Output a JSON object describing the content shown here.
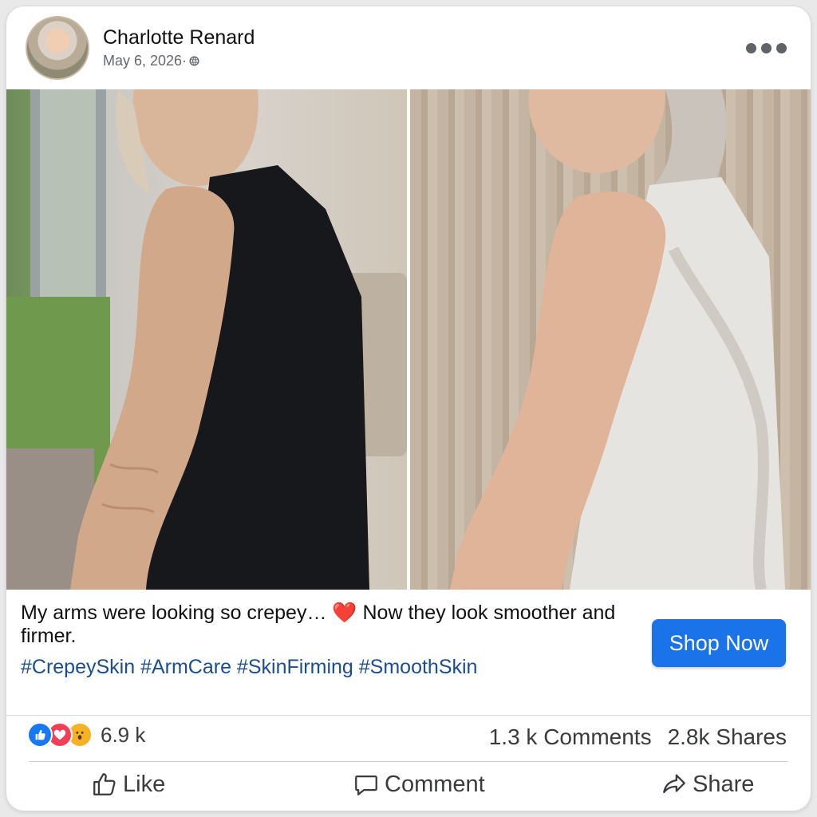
{
  "post": {
    "author": "Charlotte Renard",
    "date": "May 6, 2026·",
    "visibility_icon": "globe-icon",
    "more_icon": "more-options-icon"
  },
  "photos": {
    "before_alt": "arm before photo",
    "after_alt": "arm after photo"
  },
  "caption": {
    "text_part1": "My arms were looking so crepey… ",
    "emoji": "❤️",
    "text_part2": " Now they look smoother and firmer.",
    "hashtags": "#CrepeySkin #ArmCare #SkinFirming #SmoothSkin"
  },
  "cta": {
    "label": "Shop Now",
    "color": "#1a73e8"
  },
  "engagement": {
    "reaction_icons": [
      "like-reaction-icon",
      "love-reaction-icon",
      "wow-reaction-icon"
    ],
    "reactions_count": "6.9 k",
    "comments": "1.3 k Comments",
    "shares": "2.8k Shares"
  },
  "actions": {
    "like": "Like",
    "comment": "Comment",
    "share": "Share"
  }
}
